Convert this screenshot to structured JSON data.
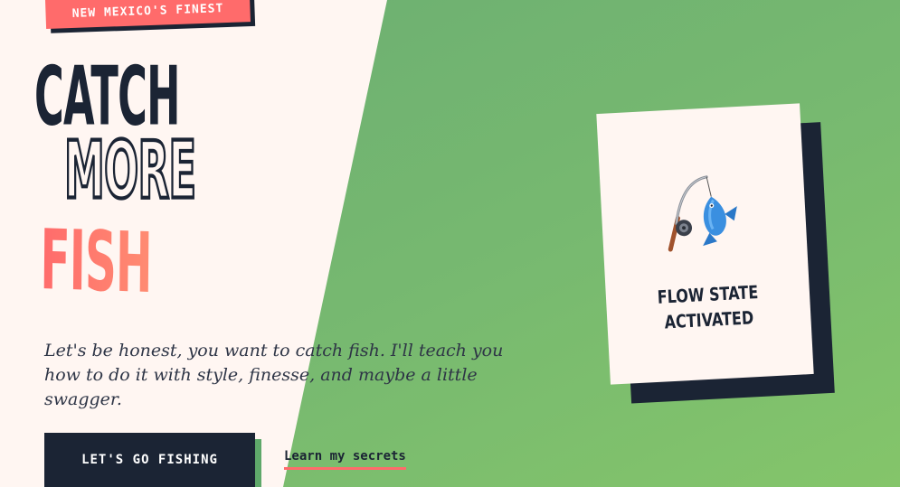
{
  "hero": {
    "badge": "New Mexico's Finest",
    "headline": {
      "line1": "Catch",
      "line2": "More",
      "line3": "Fish"
    },
    "tagline": "Let's be honest, you want to catch fish. I'll teach you how to do it with style, finesse, and maybe a little swagger.",
    "cta_label": "Let's go fishing",
    "secondary_link": "Learn my secrets"
  },
  "card": {
    "icon": "fishing-pole-and-fish-icon",
    "line1": "Flow state",
    "line2": "activated"
  },
  "colors": {
    "coral": "#ff6b6b",
    "navy": "#1b2434",
    "green": "#77b970",
    "cream": "#fff6f2"
  }
}
